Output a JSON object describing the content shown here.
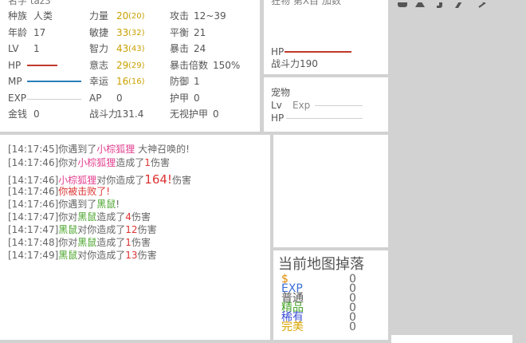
{
  "stats": {
    "row0_partial": "名字 taz3",
    "rows": [
      {
        "label": "种族",
        "value": "人类",
        "b_label": "力量",
        "b_val": "20",
        "b_max": "(20)",
        "c_label": "攻击",
        "c_val": "12~39"
      },
      {
        "label": "年龄",
        "value": "17",
        "b_label": "敏捷",
        "b_val": "33",
        "b_max": "(32)",
        "c_label": "平衡",
        "c_val": "21"
      },
      {
        "label": "LV",
        "value": "1",
        "b_label": "智力",
        "b_val": "43",
        "b_max": "(43)",
        "c_label": "暴击",
        "c_val": "24"
      },
      {
        "label": "HP",
        "value": "",
        "b_label": "意志",
        "b_val": "29",
        "b_max": "(29)",
        "c_label": "暴击倍数",
        "c_val": "150%"
      },
      {
        "label": "MP",
        "value": "",
        "b_label": "幸运",
        "b_val": "16",
        "b_max": "(16)",
        "c_label": "防御",
        "c_val": "1"
      },
      {
        "label": "EXP",
        "value": "",
        "b_label": "AP",
        "b_val": "0",
        "b_max": "",
        "c_label": "护甲",
        "c_val": "0"
      },
      {
        "label": "金钱",
        "value": "0",
        "b_label": "战斗力",
        "b_val": "131.4",
        "b_max": "",
        "c_label": "无视护甲",
        "c_val": "0"
      }
    ],
    "hp_color": "#c0392b",
    "mp_color": "#2a7fb8"
  },
  "enemy": {
    "top_partial": "狂物 第X目 加数",
    "hp_label": "HP",
    "power_label": "战斗力190"
  },
  "pet": {
    "title": "宠物",
    "lv_label": "Lv",
    "exp_label": "Exp",
    "hp_label": "HP"
  },
  "log": [
    [
      {
        "t": "[14:17:45]你遇到了"
      },
      {
        "t": "小棕狐狸",
        "c": "pink"
      },
      {
        "t": " 大神召唤的!"
      }
    ],
    [
      {
        "t": "[14:17:46]你对"
      },
      {
        "t": "小棕狐狸",
        "c": "pink"
      },
      {
        "t": "造成了"
      },
      {
        "t": "1",
        "c": "red"
      },
      {
        "t": "伤害"
      }
    ],
    [
      {
        "t": "[14:17:46]"
      },
      {
        "t": "小棕狐狸",
        "c": "pink"
      },
      {
        "t": "对你造成了"
      },
      {
        "t": "164!",
        "c": "red",
        "big": true
      },
      {
        "t": "伤害"
      }
    ],
    [
      {
        "t": "[14:17:46]"
      },
      {
        "t": "你被击败了!",
        "c": "red"
      }
    ],
    [
      {
        "t": "[14:17:46]你遇到了"
      },
      {
        "t": "黑鼠",
        "c": "green"
      },
      {
        "t": "!"
      }
    ],
    [
      {
        "t": "[14:17:47]你对"
      },
      {
        "t": "黑鼠",
        "c": "green"
      },
      {
        "t": "造成了"
      },
      {
        "t": "4",
        "c": "red"
      },
      {
        "t": "伤害"
      }
    ],
    [
      {
        "t": "[14:17:47]"
      },
      {
        "t": "黑鼠",
        "c": "green"
      },
      {
        "t": "对你造成了"
      },
      {
        "t": "12",
        "c": "red"
      },
      {
        "t": "伤害"
      }
    ],
    [
      {
        "t": "[14:17:48]你对"
      },
      {
        "t": "黑鼠",
        "c": "green"
      },
      {
        "t": "造成了"
      },
      {
        "t": "1",
        "c": "red"
      },
      {
        "t": "伤害"
      }
    ],
    [
      {
        "t": "[14:17:49]"
      },
      {
        "t": "黑鼠",
        "c": "green"
      },
      {
        "t": "对你造成了"
      },
      {
        "t": "13",
        "c": "red"
      },
      {
        "t": "伤害"
      }
    ]
  ],
  "drops": {
    "title": "当前地图掉落",
    "items": [
      {
        "label": "$",
        "value": "0",
        "color": "#e08a00"
      },
      {
        "label": "EXP",
        "value": "0",
        "color": "#3b6fd6"
      },
      {
        "label": "普通",
        "value": "0",
        "color": "#555555"
      },
      {
        "label": "精品",
        "value": "0",
        "color": "#4aa52b"
      },
      {
        "label": "稀有",
        "value": "0",
        "color": "#3b50d6"
      },
      {
        "label": "完美",
        "value": "0",
        "color": "#d9a400"
      }
    ]
  },
  "toolbar_icons": [
    "sword-icon",
    "dagger-icon",
    "bow-icon",
    "wand-icon",
    "arrow-icon"
  ]
}
